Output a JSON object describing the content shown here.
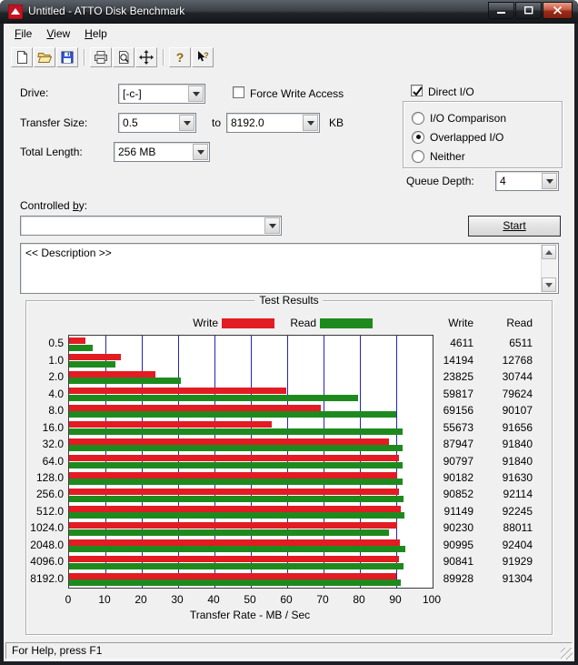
{
  "window": {
    "title": "Untitled - ATTO Disk Benchmark",
    "status": "For Help, press F1"
  },
  "menu": {
    "items": [
      "File",
      "View",
      "Help"
    ]
  },
  "toolbar": {
    "icons": [
      "new-document",
      "open-folder",
      "save",
      "print",
      "print-preview",
      "pan",
      "help",
      "context-help"
    ]
  },
  "form": {
    "drive": {
      "label": "Drive:",
      "value": "[-c-]"
    },
    "force_write_access": {
      "label": "Force Write Access",
      "checked": false
    },
    "direct_io": {
      "label": "Direct I/O",
      "checked": true
    },
    "transfer_size": {
      "label": "Transfer Size:",
      "from": "0.5",
      "to_word": "to",
      "to": "8192.0",
      "unit": "KB"
    },
    "io_modes": {
      "options": [
        "I/O Comparison",
        "Overlapped I/O",
        "Neither"
      ],
      "selected_index": 1
    },
    "total_length": {
      "label": "Total Length:",
      "value": "256 MB"
    },
    "queue_depth": {
      "label": "Queue Depth:",
      "value": "4"
    },
    "controlled_by": {
      "pre": "Controlled ",
      "mnemonic": "b",
      "post": "y:",
      "value": ""
    },
    "start_button": "Start",
    "description": "<< Description >>"
  },
  "results": {
    "group_title": "Test Results",
    "legend": {
      "write": "Write",
      "read": "Read"
    },
    "columns": {
      "write": "Write",
      "read": "Read"
    },
    "xlabel": "Transfer Rate - MB / Sec"
  },
  "chart_data": {
    "type": "bar",
    "orientation": "horizontal",
    "title": "Test Results",
    "xlabel": "Transfer Rate - MB / Sec",
    "ylabel": "",
    "xlim": [
      0,
      100
    ],
    "x_ticks": [
      0,
      10,
      20,
      30,
      40,
      50,
      60,
      70,
      80,
      90,
      100
    ],
    "grid": "vertical",
    "gridline_color": "#2323c8",
    "legend_position": "top",
    "value_unit": "KB/s",
    "axis_unit_divisor": 1000,
    "categories": [
      "0.5",
      "1.0",
      "2.0",
      "4.0",
      "8.0",
      "16.0",
      "32.0",
      "64.0",
      "128.0",
      "256.0",
      "512.0",
      "1024.0",
      "2048.0",
      "4096.0",
      "8192.0"
    ],
    "series": [
      {
        "name": "Write",
        "color": "#e31b23",
        "values": [
          4611,
          14194,
          23825,
          59817,
          69156,
          55673,
          87947,
          90797,
          90182,
          90852,
          91149,
          90230,
          90995,
          90841,
          89928
        ]
      },
      {
        "name": "Read",
        "color": "#1e8a1e",
        "values": [
          6511,
          12768,
          30744,
          79624,
          90107,
          91656,
          91840,
          91840,
          91630,
          92114,
          92245,
          88011,
          92404,
          91929,
          91304
        ]
      }
    ]
  }
}
